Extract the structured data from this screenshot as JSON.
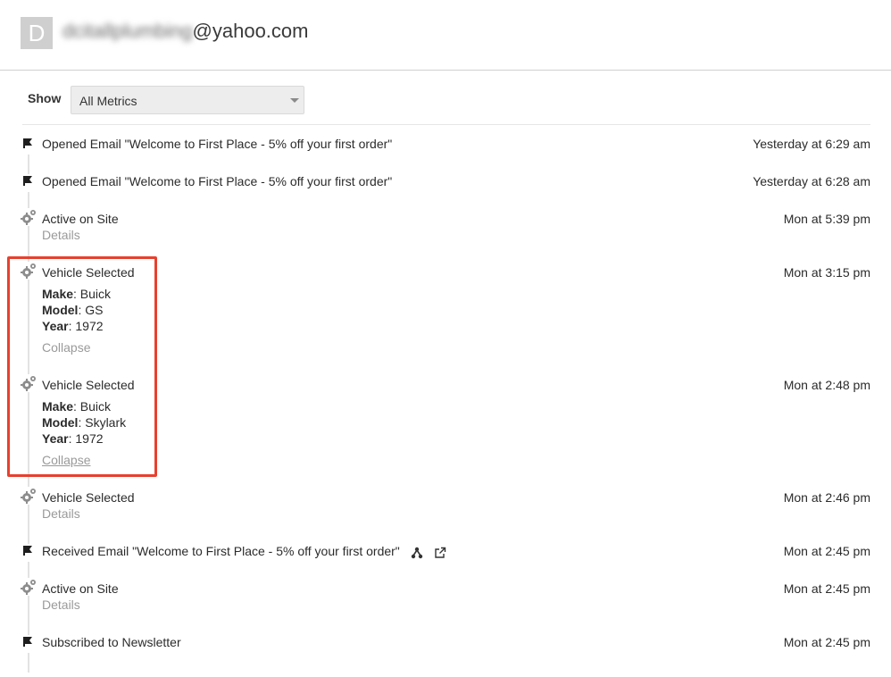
{
  "profile": {
    "avatar_initial": "D",
    "email_local_blurred": "dcitallplumbing",
    "email_domain": "@yahoo.com"
  },
  "filter": {
    "label": "Show",
    "selected": "All Metrics"
  },
  "events": [
    {
      "title": "Opened Email \"Welcome to First Place - 5% off your first order\"",
      "time": "Yesterday at 6:29 am",
      "icon": "flag-icon"
    },
    {
      "title": "Opened Email \"Welcome to First Place - 5% off your first order\"",
      "time": "Yesterday at 6:28 am",
      "icon": "flag-icon"
    },
    {
      "title": "Active on Site",
      "time": "Mon at 5:39 pm",
      "icon": "gears-icon",
      "details": "Details"
    },
    {
      "title": "Vehicle Selected",
      "time": "Mon at 3:15 pm",
      "icon": "gears-icon",
      "props": [
        {
          "key": "Make",
          "value": ": Buick"
        },
        {
          "key": "Model",
          "value": ": GS"
        },
        {
          "key": "Year",
          "value": ": 1972"
        }
      ],
      "collapse": "Collapse"
    },
    {
      "title": "Vehicle Selected",
      "time": "Mon at 2:48 pm",
      "icon": "gears-icon",
      "props": [
        {
          "key": "Make",
          "value": ": Buick"
        },
        {
          "key": "Model",
          "value": ": Skylark"
        },
        {
          "key": "Year",
          "value": ": 1972"
        }
      ],
      "collapse": "Collapse"
    },
    {
      "title": "Vehicle Selected",
      "time": "Mon at 2:46 pm",
      "icon": "gears-icon",
      "details": "Details"
    },
    {
      "title": "Received Email \"Welcome to First Place - 5% off your first order\"",
      "time": "Mon at 2:45 pm",
      "icon": "flag-icon"
    },
    {
      "title": "Active on Site",
      "time": "Mon at 2:45 pm",
      "icon": "gears-icon",
      "details": "Details"
    },
    {
      "title": "Subscribed to Newsletter",
      "time": "Mon at 2:45 pm",
      "icon": "flag-icon"
    }
  ],
  "colors": {
    "highlight": "#e8402e",
    "muted_text": "#9a9a9a",
    "icon_gray": "#8d8d8d"
  }
}
